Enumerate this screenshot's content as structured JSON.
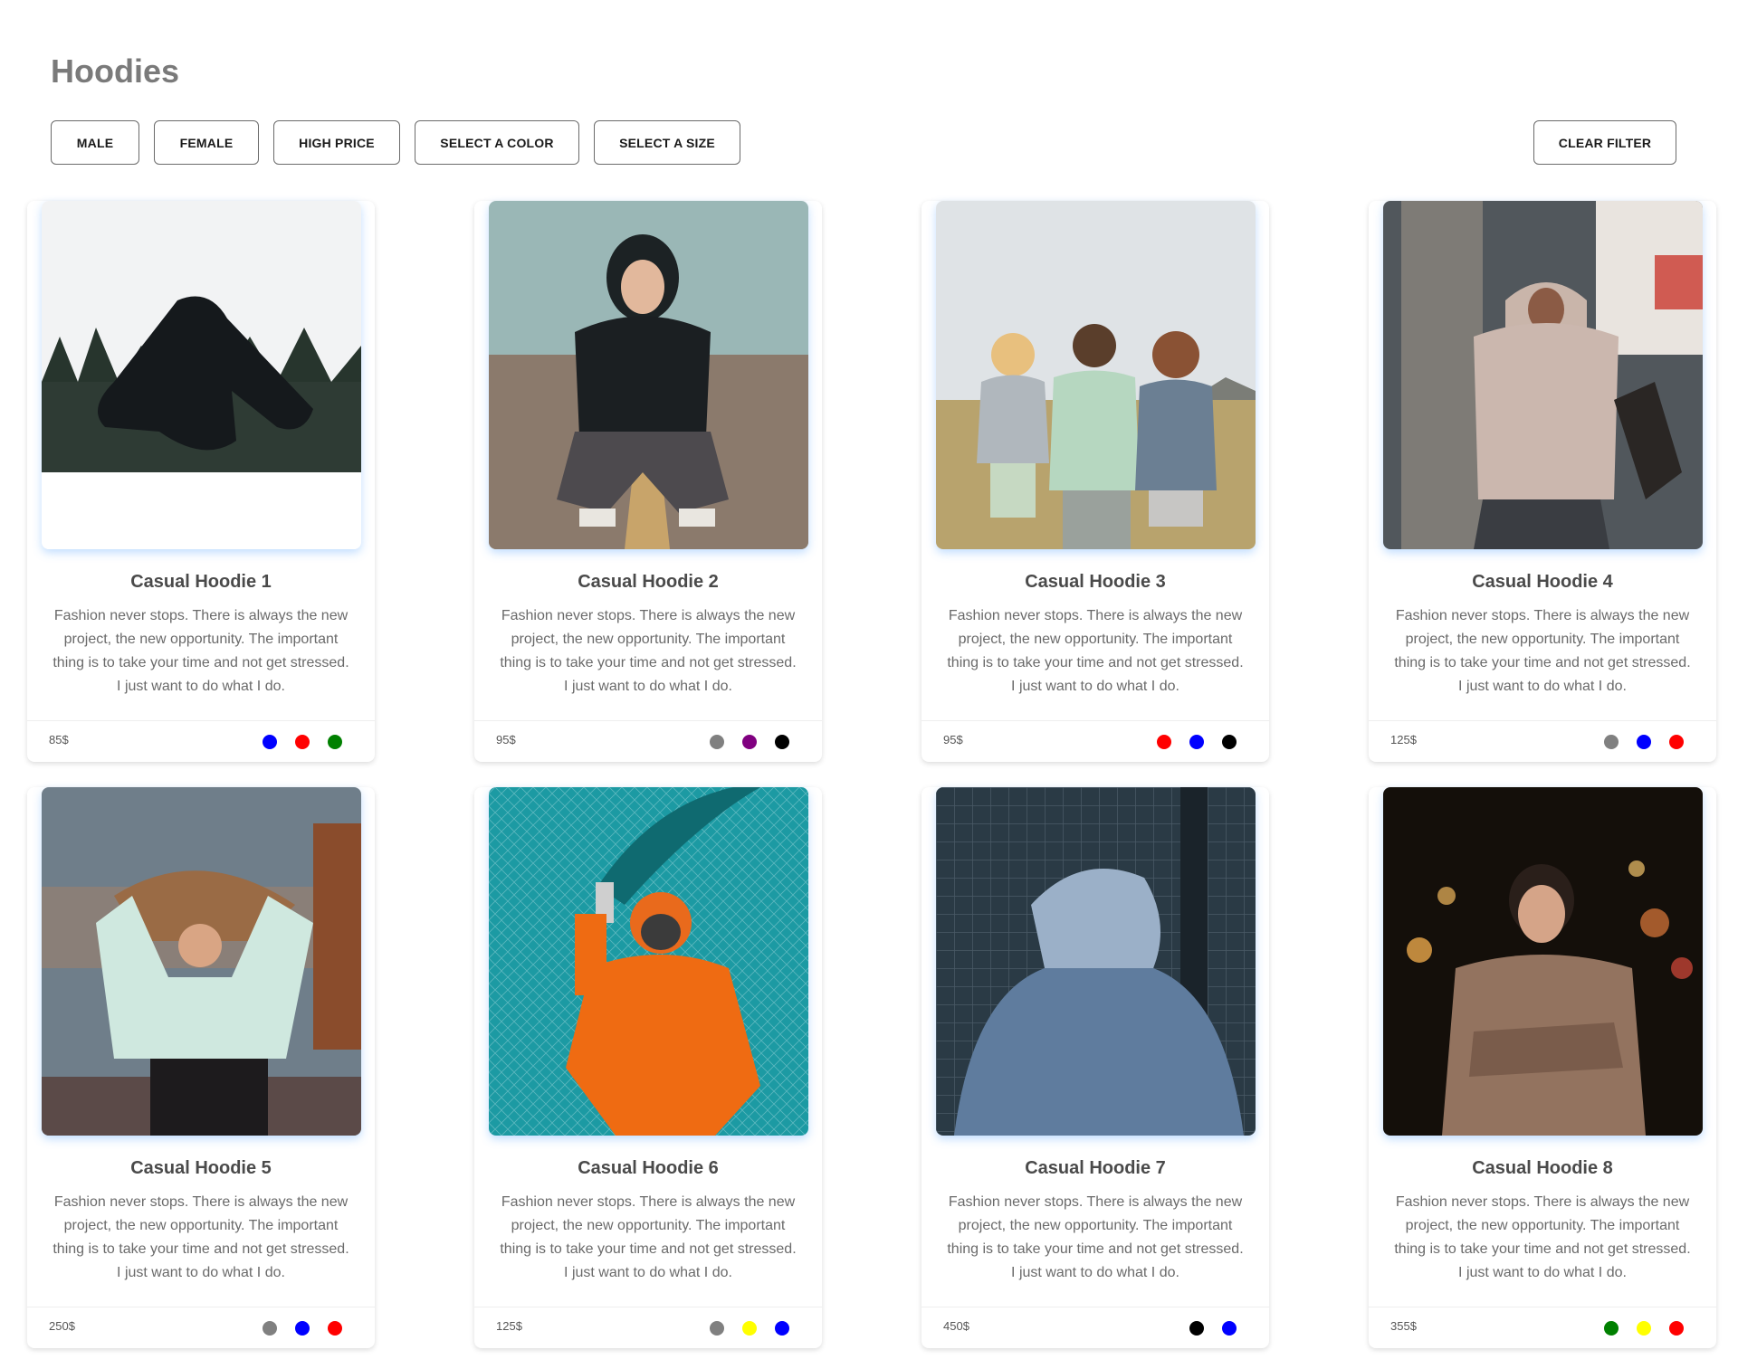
{
  "page": {
    "title": "Hoodies"
  },
  "filters": {
    "male": "MALE",
    "female": "FEMALE",
    "high_price": "HIGH PRICE",
    "color": "SELECT A COLOR",
    "size": "SELECT A SIZE",
    "clear": "CLEAR FILTER"
  },
  "products": [
    {
      "title": "Casual Hoodie 1",
      "description": "Fashion never stops. There is always the new project, the new opportunity. The important thing is to take your time and not get stressed. I just want to do what I do.",
      "price": "85$",
      "colors": [
        "#0000ff",
        "#ff0000",
        "#008000"
      ],
      "photo": "hoodie-thrown-in-snow"
    },
    {
      "title": "Casual Hoodie 2",
      "description": "Fashion never stops. There is always the new project, the new opportunity. The important thing is to take your time and not get stressed. I just want to do what I do.",
      "price": "95$",
      "colors": [
        "#808080",
        "#800080",
        "#000000"
      ],
      "photo": "woman-crouching-on-road"
    },
    {
      "title": "Casual Hoodie 3",
      "description": "Fashion never stops. There is always the new project, the new opportunity. The important thing is to take your time and not get stressed. I just want to do what I do.",
      "price": "95$",
      "colors": [
        "#ff0000",
        "#0000ff",
        "#000000"
      ],
      "photo": "three-friends-in-field"
    },
    {
      "title": "Casual Hoodie 4",
      "description": "Fashion never stops. There is always the new project, the new opportunity. The important thing is to take your time and not get stressed. I just want to do what I do.",
      "price": "125$",
      "colors": [
        "#808080",
        "#0000ff",
        "#ff0000"
      ],
      "photo": "man-in-beige-hoodie-by-pillar"
    },
    {
      "title": "Casual Hoodie 5",
      "description": "Fashion never stops. There is always the new project, the new opportunity. The important thing is to take your time and not get stressed. I just want to do what I do.",
      "price": "250$",
      "colors": [
        "#808080",
        "#0000ff",
        "#ff0000"
      ],
      "photo": "woman-flipping-hair-outdoors"
    },
    {
      "title": "Casual Hoodie 6",
      "description": "Fashion never stops. There is always the new project, the new opportunity. The important thing is to take your time and not get stressed. I just want to do what I do.",
      "price": "125$",
      "colors": [
        "#808080",
        "#ffff00",
        "#0000ff"
      ],
      "photo": "person-with-smoke-flare"
    },
    {
      "title": "Casual Hoodie 7",
      "description": "Fashion never stops. There is always the new project, the new opportunity. The important thing is to take your time and not get stressed. I just want to do what I do.",
      "price": "450$",
      "colors": [
        "#000000",
        "#0000ff"
      ],
      "photo": "hooded-figure-from-behind"
    },
    {
      "title": "Casual Hoodie 8",
      "description": "Fashion never stops. There is always the new project, the new opportunity. The important thing is to take your time and not get stressed. I just want to do what I do.",
      "price": "355$",
      "colors": [
        "#008000",
        "#ffff00",
        "#ff0000"
      ],
      "photo": "woman-in-city-lights-at-night"
    }
  ]
}
